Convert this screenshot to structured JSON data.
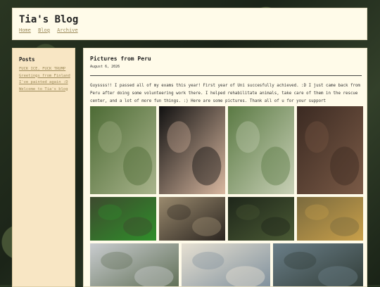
{
  "site": {
    "title": "Tia's Blog"
  },
  "nav": {
    "home": "Home",
    "blog": "Blog",
    "archive": "Archive"
  },
  "sidebar": {
    "heading": "Posts",
    "posts": [
      "FUCK ICE, FUCK TRUMP",
      "Greetings from Finland",
      "I've painted again :D",
      "Welcome to Tia's blog"
    ]
  },
  "post": {
    "title": "Pictures from Peru",
    "date": "August 6, 2026",
    "body": "Guyssss!! I passed all of my exams this year! First year of Uni succesfully achieved. :D I just came back from Peru after doing some volunteering work there. I helped rehabilitate animals, take care of them in the rescue center, and a lot of more fun things. :) Here are some pictures. Thank all of u for your support"
  },
  "gallery": [
    {
      "subject": "forest-bird",
      "colors": [
        "#4d6b35",
        "#a9b48c"
      ]
    },
    {
      "subject": "frog-in-hand",
      "colors": [
        "#111111",
        "#d9b8a0"
      ]
    },
    {
      "subject": "jungle-trees",
      "colors": [
        "#5b7a44",
        "#c8d0b6"
      ]
    },
    {
      "subject": "night-sky",
      "colors": [
        "#3b2a22",
        "#7a5a46"
      ]
    },
    {
      "subject": "green-parrot",
      "colors": [
        "#3d4a2e",
        "#2f8f2a"
      ]
    },
    {
      "subject": "monkey-fence",
      "colors": [
        "#9a8a6e",
        "#2b2520"
      ]
    },
    {
      "subject": "dark-forest",
      "colors": [
        "#1e261a",
        "#4a5a34"
      ]
    },
    {
      "subject": "jaguar",
      "colors": [
        "#7a6a3e",
        "#c9a04a"
      ]
    },
    {
      "subject": "cloudy-palms",
      "colors": [
        "#c9cccf",
        "#5b6b50"
      ]
    },
    {
      "subject": "boat-interior",
      "colors": [
        "#e6e0d2",
        "#7a8c9a"
      ]
    },
    {
      "subject": "river",
      "colors": [
        "#6a7e88",
        "#2f3a34"
      ]
    }
  ]
}
